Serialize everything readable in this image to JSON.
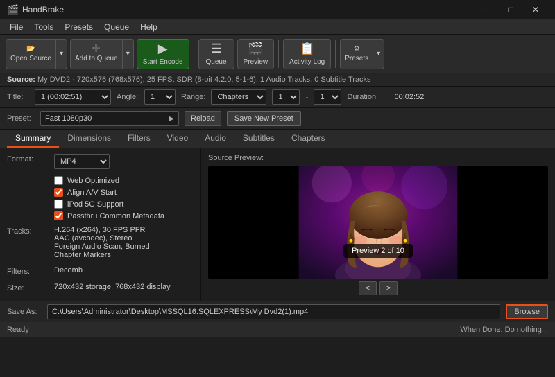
{
  "titlebar": {
    "app_name": "HandBrake",
    "icon": "🎬"
  },
  "menubar": {
    "items": [
      "File",
      "Tools",
      "Presets",
      "Queue",
      "Help"
    ]
  },
  "toolbar": {
    "open_source": "Open Source",
    "add_to_queue": "Add to Queue",
    "start_encode": "Start Encode",
    "queue": "Queue",
    "preview": "Preview",
    "activity_log": "Activity Log",
    "presets": "Presets"
  },
  "source": {
    "label": "Source:",
    "value": "My DVD2 · 720x576 (768x576), 25 FPS, SDR (8-bit 4:2:0, 5-1-6), 1 Audio Tracks, 0 Subtitle Tracks"
  },
  "title_row": {
    "title_label": "Title:",
    "title_value": "1 (00:02:51)",
    "angle_label": "Angle:",
    "angle_value": "1",
    "range_label": "Range:",
    "range_value": "Chapters",
    "from_value": "1",
    "to_value": "1",
    "duration_label": "Duration:",
    "duration_value": "00:02:52"
  },
  "preset_row": {
    "label": "Preset:",
    "value": "Fast 1080p30",
    "reload_btn": "Reload",
    "save_new_btn": "Save New Preset"
  },
  "tabs": [
    "Summary",
    "Dimensions",
    "Filters",
    "Video",
    "Audio",
    "Subtitles",
    "Chapters"
  ],
  "active_tab": "Summary",
  "format": {
    "label": "Format:",
    "value": "MP4",
    "web_optimized": {
      "label": "Web Optimized",
      "checked": false
    },
    "align_av": {
      "label": "Align A/V Start",
      "checked": true
    },
    "ipod_support": {
      "label": "iPod 5G Support",
      "checked": false
    },
    "passthru_metadata": {
      "label": "Passthru Common Metadata",
      "checked": true
    }
  },
  "tracks": {
    "label": "Tracks:",
    "lines": [
      "H.264 (x264), 30 FPS PFR",
      "AAC (avcodec), Stereo",
      "Foreign Audio Scan, Burned",
      "Chapter Markers"
    ]
  },
  "filters": {
    "label": "Filters:",
    "value": "Decomb"
  },
  "size": {
    "label": "Size:",
    "value": "720x432 storage, 768x432 display"
  },
  "preview": {
    "label": "Source Preview:",
    "overlay": "Preview 2 of 10",
    "prev_btn": "<",
    "next_btn": ">"
  },
  "saveas": {
    "label": "Save As:",
    "path": "C:\\Users\\Administrator\\Desktop\\MSSQL16.SQLEXPRESS\\My Dvd2(1).mp4",
    "browse_btn": "Browse"
  },
  "statusbar": {
    "left": "Ready",
    "right_label": "When Done:",
    "right_value": "Do nothing..."
  }
}
